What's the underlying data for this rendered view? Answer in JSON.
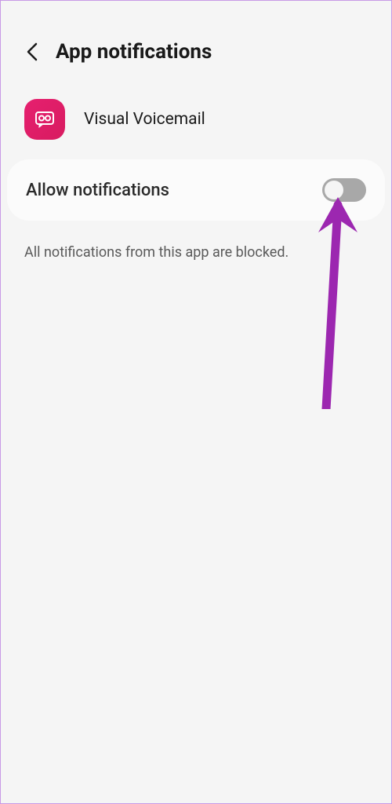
{
  "header": {
    "title": "App notifications"
  },
  "app": {
    "name": "Visual Voicemail"
  },
  "setting": {
    "label": "Allow notifications",
    "enabled": false
  },
  "status": {
    "text": "All notifications from this app are blocked."
  }
}
